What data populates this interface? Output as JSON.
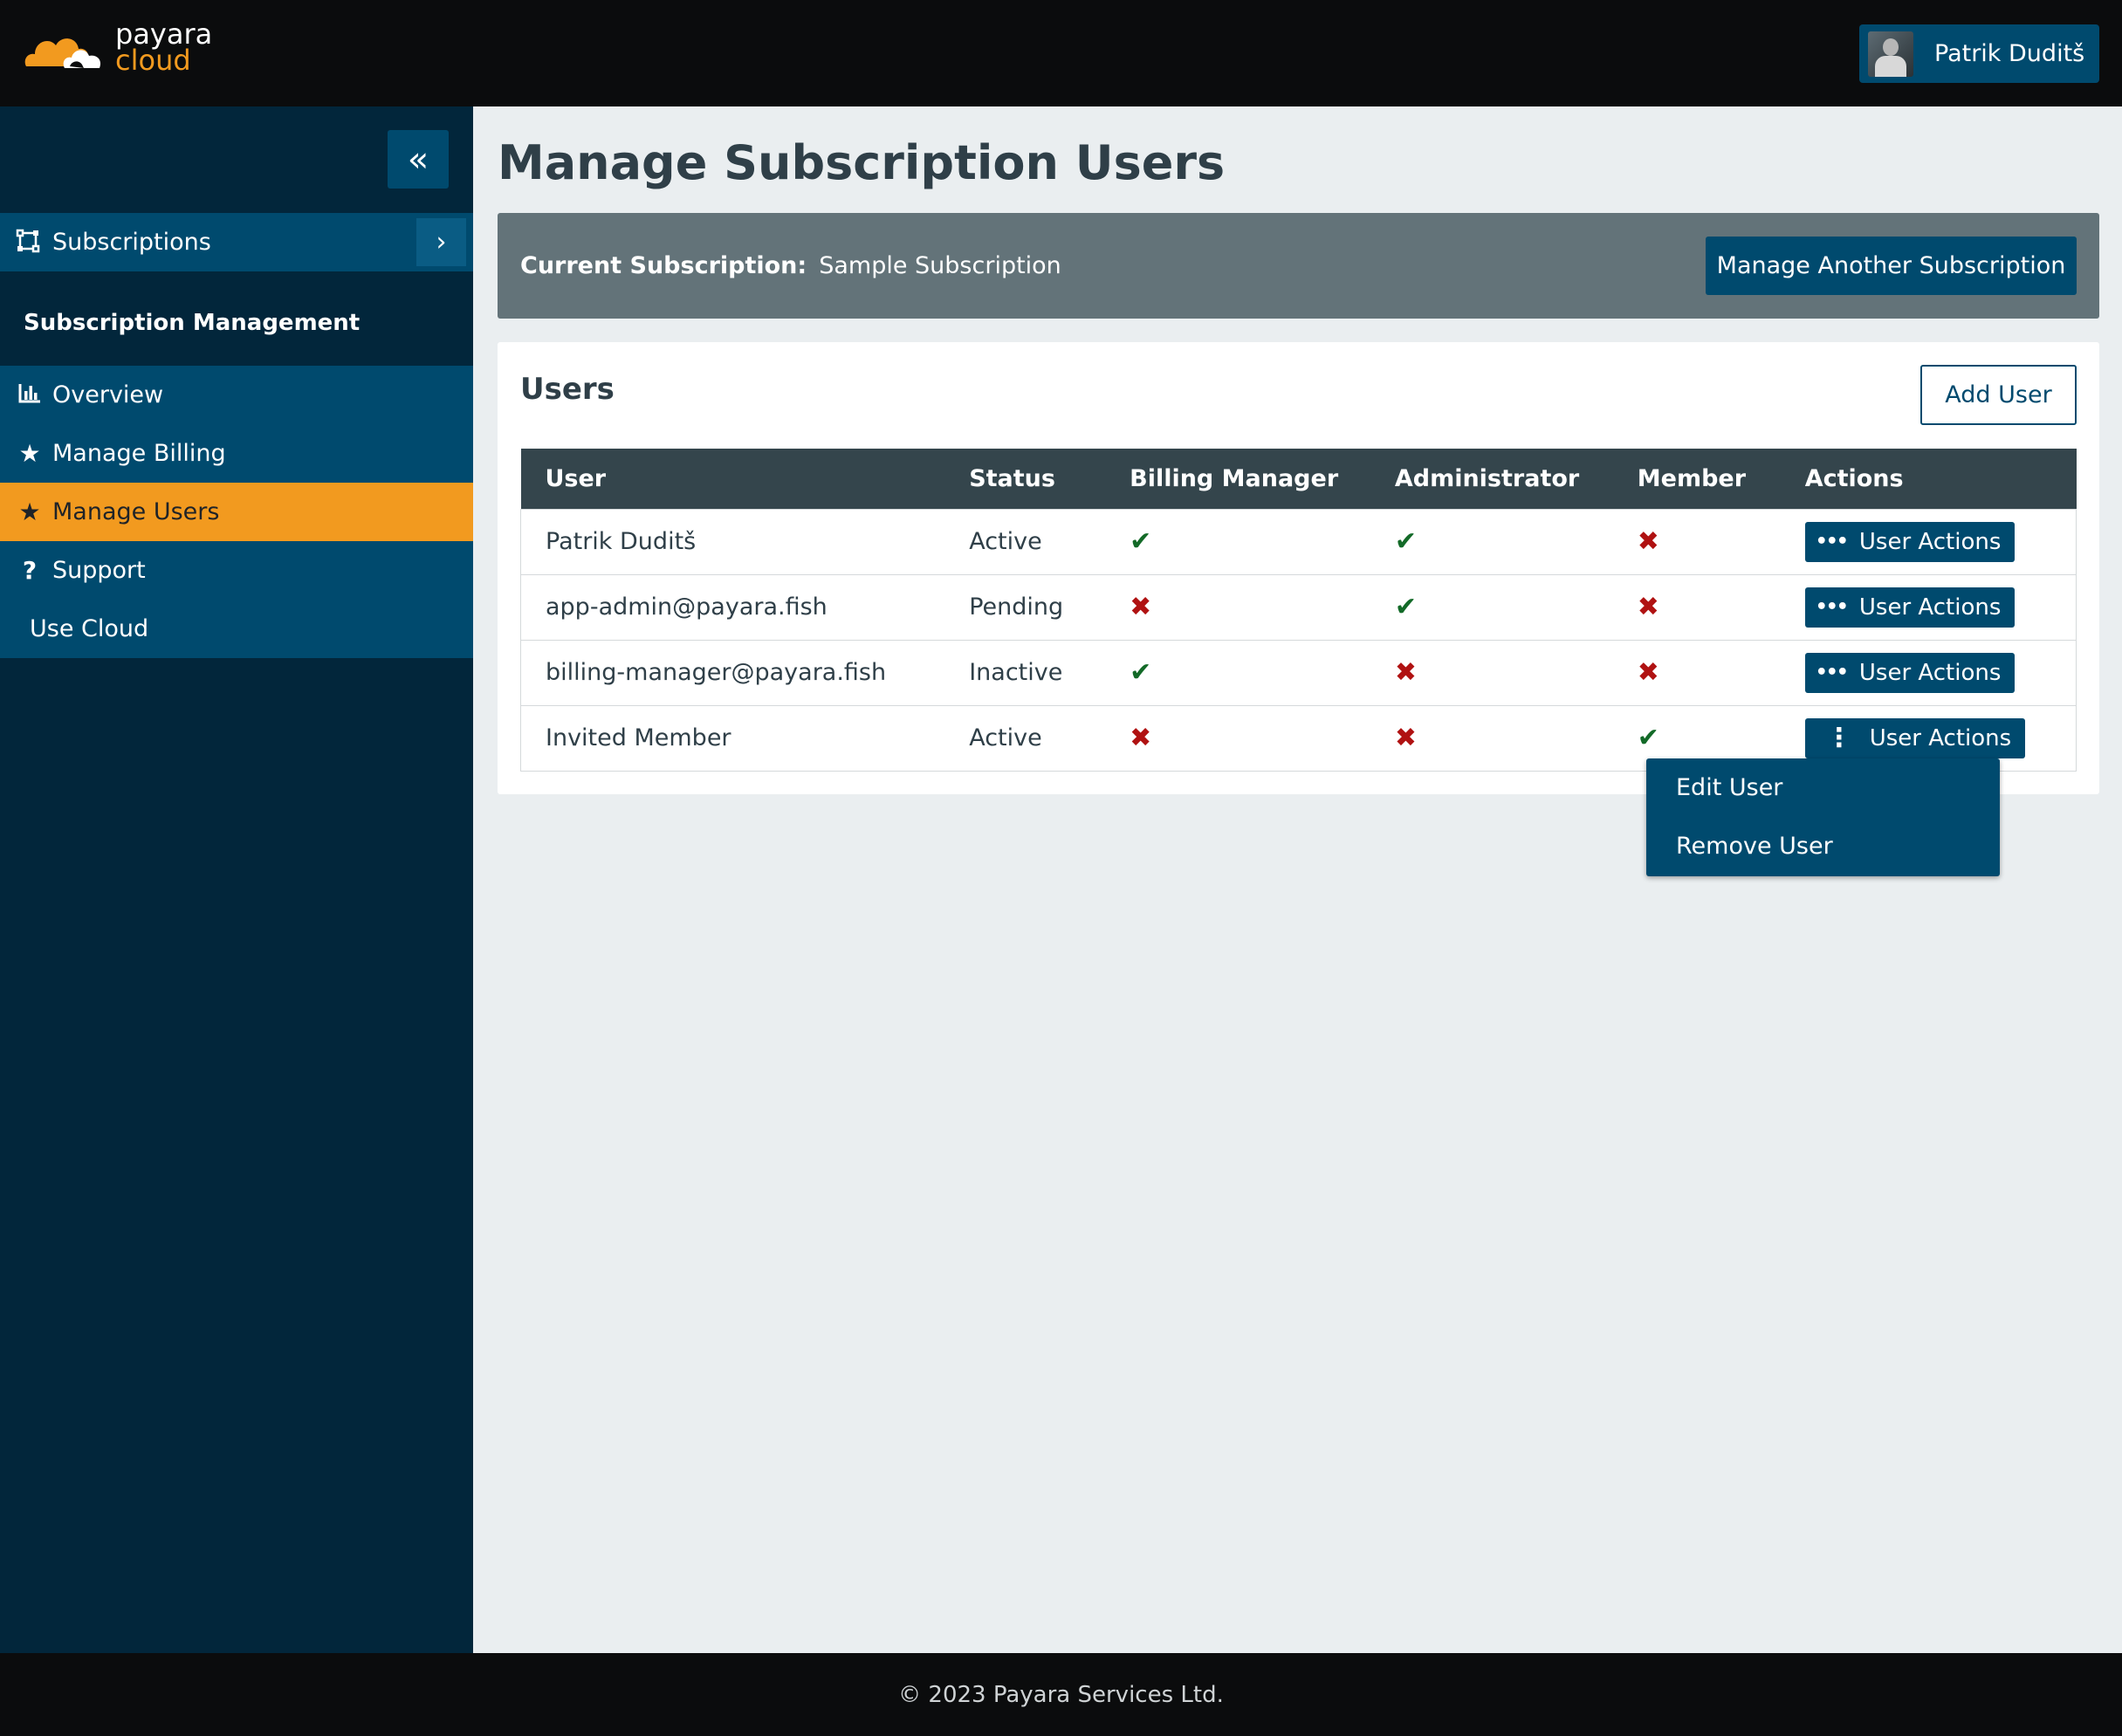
{
  "brand": {
    "line1": "payara",
    "line2": "cloud"
  },
  "user": {
    "name": "Patrik Duditš"
  },
  "sidebar": {
    "collapse_icon": "«",
    "subscriptions_label": "Subscriptions",
    "section_title": "Subscription Management",
    "items": [
      {
        "label": "Overview",
        "icon": "bar-chart-icon",
        "glyph": "▐",
        "active": false
      },
      {
        "label": "Manage Billing",
        "icon": "star-icon",
        "glyph": "★",
        "active": false
      },
      {
        "label": "Manage Users",
        "icon": "star-icon",
        "glyph": "★",
        "active": true
      },
      {
        "label": "Support",
        "icon": "question-icon",
        "glyph": "?",
        "active": false
      },
      {
        "label": "Use Cloud",
        "icon": "",
        "glyph": "",
        "active": false
      }
    ]
  },
  "main": {
    "title": "Manage Subscription Users",
    "current_subscription_label": "Current Subscription:",
    "current_subscription_value": "Sample Subscription",
    "manage_another_label": "Manage Another Subscription"
  },
  "users_card": {
    "title": "Users",
    "add_user_label": "Add User",
    "columns": [
      "User",
      "Status",
      "Billing Manager",
      "Administrator",
      "Member",
      "Actions"
    ],
    "rows": [
      {
        "user": "Patrik Duditš",
        "status": "Active",
        "billing_manager": true,
        "administrator": true,
        "member": false,
        "action": "User Actions"
      },
      {
        "user": "app-admin@payara.fish",
        "status": "Pending",
        "billing_manager": false,
        "administrator": true,
        "member": false,
        "action": "User Actions"
      },
      {
        "user": "billing-manager@payara.fish",
        "status": "Inactive",
        "billing_manager": true,
        "administrator": false,
        "member": false,
        "action": "User Actions"
      },
      {
        "user": "Invited Member",
        "status": "Active",
        "billing_manager": false,
        "administrator": false,
        "member": true,
        "action": "User Actions"
      }
    ]
  },
  "dropdown": {
    "items": [
      "Edit User",
      "Remove User"
    ]
  },
  "footer": {
    "text": "© 2023 Payara Services Ltd."
  },
  "colors": {
    "accent": "#f29a1f",
    "primary": "#004a6e",
    "sidebar": "#02263b",
    "ok": "#136a28",
    "no": "#b01212"
  }
}
